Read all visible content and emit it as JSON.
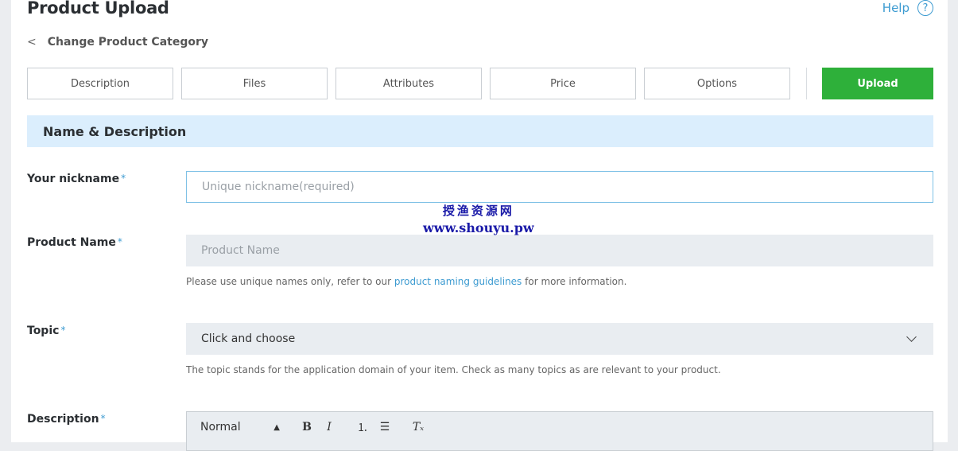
{
  "header": {
    "title": "Product Upload",
    "help_label": "Help",
    "help_glyph": "?"
  },
  "back": {
    "label": "Change Product Category",
    "glyph": "<"
  },
  "tabs": [
    {
      "label": "Description"
    },
    {
      "label": "Files"
    },
    {
      "label": "Attributes"
    },
    {
      "label": "Price"
    },
    {
      "label": "Options"
    }
  ],
  "upload_label": "Upload",
  "section": {
    "title": "Name & Description"
  },
  "fields": {
    "nickname": {
      "label": "Your nickname",
      "required": "*",
      "placeholder": "Unique nickname(required)",
      "value": ""
    },
    "product_name": {
      "label": "Product Name",
      "required": "*",
      "placeholder": "Product Name",
      "value": "",
      "hint_before": "Please use unique names only, refer to our ",
      "hint_link": "product naming guidelines",
      "hint_after": " for more information."
    },
    "topic": {
      "label": "Topic",
      "required": "*",
      "selected": "Click and choose",
      "hint": "The topic stands for the application domain of your item. Check as many topics as are relevant to your product."
    },
    "description": {
      "label": "Description",
      "required": "*"
    }
  },
  "editor_toolbar": {
    "format": "Normal",
    "bold": "B",
    "italic": "I",
    "ordered_list": "⒈",
    "bullet_list": "☰",
    "clear": "Tₓ"
  },
  "watermark": {
    "line1": "授渔资源网",
    "line2": "www.shouyu.pw"
  },
  "colors": {
    "accent": "#3d9bd1",
    "upload": "#2eb03a",
    "section_bg": "#dbeefd",
    "field_bg": "#e9edf1"
  }
}
